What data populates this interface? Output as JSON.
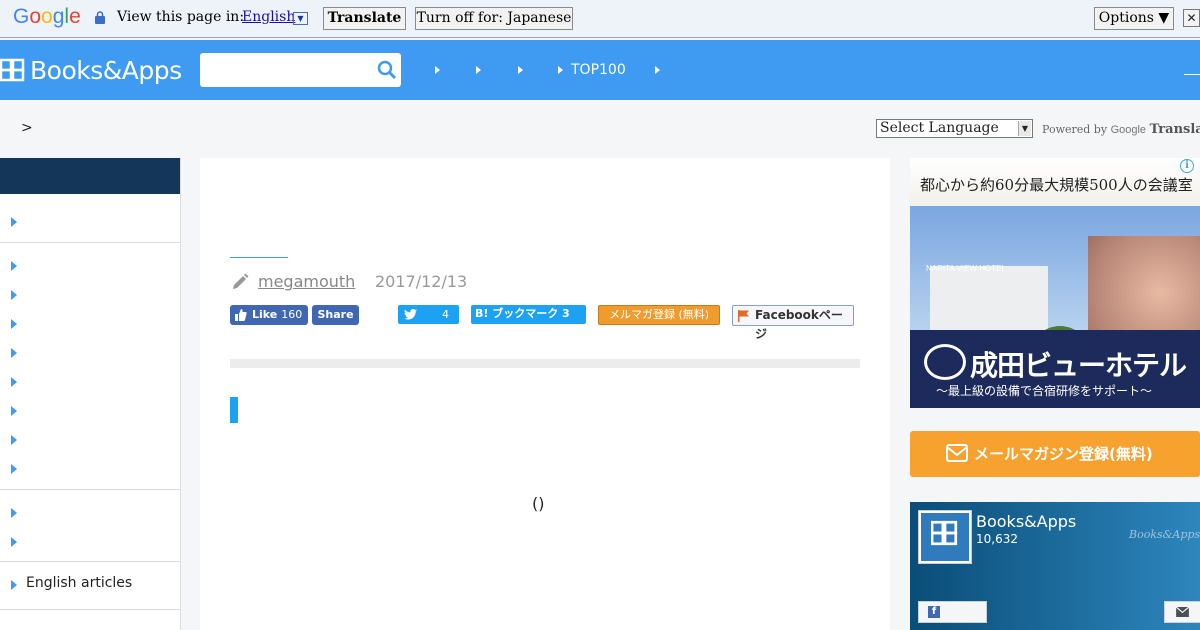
{
  "gbar": {
    "logo": "Google",
    "view_text": "View this page in:",
    "language": "English",
    "translate_label": "Translate",
    "turn_off_label": "Turn off for: Japanese",
    "options_label": "Options ▼",
    "close_label": "✕"
  },
  "header": {
    "logo_text": "Books&Apps",
    "search_placeholder": "",
    "nav": [
      "",
      "",
      "",
      "TOP100",
      ""
    ]
  },
  "breadcrumb": {
    "separator": ">"
  },
  "translate_widget": {
    "select_label": "Select Language",
    "powered_by": "Powered by",
    "google": "Google",
    "translate": "Translate"
  },
  "sidebar": {
    "items": [
      "",
      "",
      "",
      "",
      "",
      "",
      "",
      "",
      "",
      "",
      "",
      "English articles"
    ]
  },
  "article": {
    "author": "megamouth",
    "date": "2017/12/13",
    "fb_like_label": "Like",
    "fb_like_count": "160",
    "fb_share_label": "Share",
    "tweet_count": "4",
    "hatena_label": "B! ブックマーク 3",
    "mailmag_label": "メルマガ登録 (無料)",
    "facebook_page_label": "Facebookページ",
    "paren": "()"
  },
  "ad": {
    "headline": "都心から約60分最大規模500人の会議室",
    "hotel_tag": "NARITA VIEW HOTEL",
    "brand": "成田ビューホテル",
    "sub": "〜最上級の設備で合宿研修をサポート〜",
    "info": "i"
  },
  "newsletter_button": "メールマガジン登録(無料)",
  "fb_widget": {
    "name": "Books&Apps",
    "count": "10,632",
    "watermark": "Books&Apps"
  },
  "colors": {
    "header_blue": "#3f9bf2",
    "sidebar_head": "#143659",
    "orange": "#f7a12f"
  }
}
